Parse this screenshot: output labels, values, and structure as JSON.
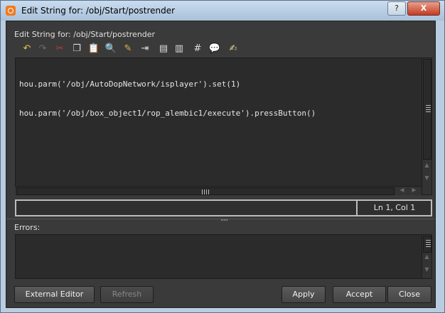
{
  "window": {
    "title": "Edit String for: /obj/Start/postrender"
  },
  "window_buttons": {
    "help": "?",
    "close": "X"
  },
  "dialog": {
    "heading": "Edit String for: /obj/Start/postrender"
  },
  "toolbar": [
    {
      "name": "undo-icon",
      "glyph": "↶"
    },
    {
      "name": "redo-icon",
      "glyph": "↷"
    },
    {
      "name": "cut-icon",
      "glyph": "✂"
    },
    {
      "name": "copy-icon",
      "glyph": "❐"
    },
    {
      "name": "paste-icon",
      "glyph": "📋"
    },
    {
      "name": "find-icon",
      "glyph": "🔍"
    },
    {
      "name": "find-replace-icon",
      "glyph": "✎"
    },
    {
      "name": "indent-icon",
      "glyph": "⇥"
    },
    {
      "name": "bookmark-next-icon",
      "glyph": "▤"
    },
    {
      "name": "bookmark-prev-icon",
      "glyph": "▥"
    },
    {
      "name": "comment-icon",
      "glyph": "#"
    },
    {
      "name": "uncomment-icon",
      "glyph": "💬"
    },
    {
      "name": "edit-notes-icon",
      "glyph": "✍"
    }
  ],
  "editor": {
    "lines": [
      "hou.parm('/obj/AutoDopNetwork/isplayer').set(1)",
      "hou.parm('/obj/box_object1/rop_alembic1/execute').pressButton()"
    ]
  },
  "status": {
    "position": "Ln 1, Col 1"
  },
  "errors": {
    "label": "Errors:"
  },
  "buttons": {
    "external_editor": "External Editor",
    "refresh": "Refresh",
    "apply": "Apply",
    "accept": "Accept",
    "close": "Close"
  }
}
